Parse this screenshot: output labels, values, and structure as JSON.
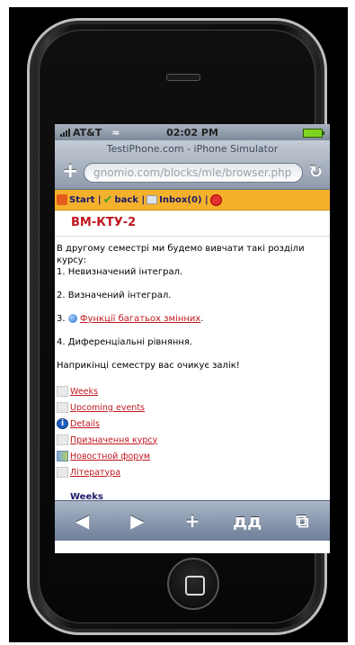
{
  "status": {
    "carrier": "AT&T",
    "time": "02:02 PM"
  },
  "browser": {
    "title": "TestiPhone.com - iPhone Simulator",
    "url": "gnomio.com/blocks/mle/browser.php",
    "plus_icon": "+",
    "reload_icon": "↻"
  },
  "nav": {
    "start": "Start |",
    "back": "back |",
    "inbox": "Inbox(0) |"
  },
  "page": {
    "heading": "ВМ-КТУ-2",
    "intro": "В другому семестрі ми будемо вивчати такі розділи курсу:",
    "item1": "1. Невизначений інтеграл.",
    "item2": "2. Визначений інтеграл.",
    "item3_prefix": "3.",
    "item3_link": "Функції багатьох змінних",
    "item3_suffix": ".",
    "item4": "4. Диференціальні рівняння.",
    "closing": "Наприкінці семестру вас очикує залік!"
  },
  "links": [
    {
      "label": "Weeks",
      "icon": "weeks-icon"
    },
    {
      "label": "Upcoming events",
      "icon": "events-icon"
    },
    {
      "label": "Details",
      "icon": "info-icon"
    },
    {
      "label": "Призначення курсу",
      "icon": "page-icon"
    },
    {
      "label": "Новостной форум",
      "icon": "forum-icon"
    },
    {
      "label": "Література",
      "icon": "page-icon"
    }
  ],
  "partial_heading": "Weeks",
  "toolbar": {
    "back": "◀",
    "forward": "▶",
    "add": "+",
    "bookmarks": "🕮",
    "pages": "⧉"
  }
}
